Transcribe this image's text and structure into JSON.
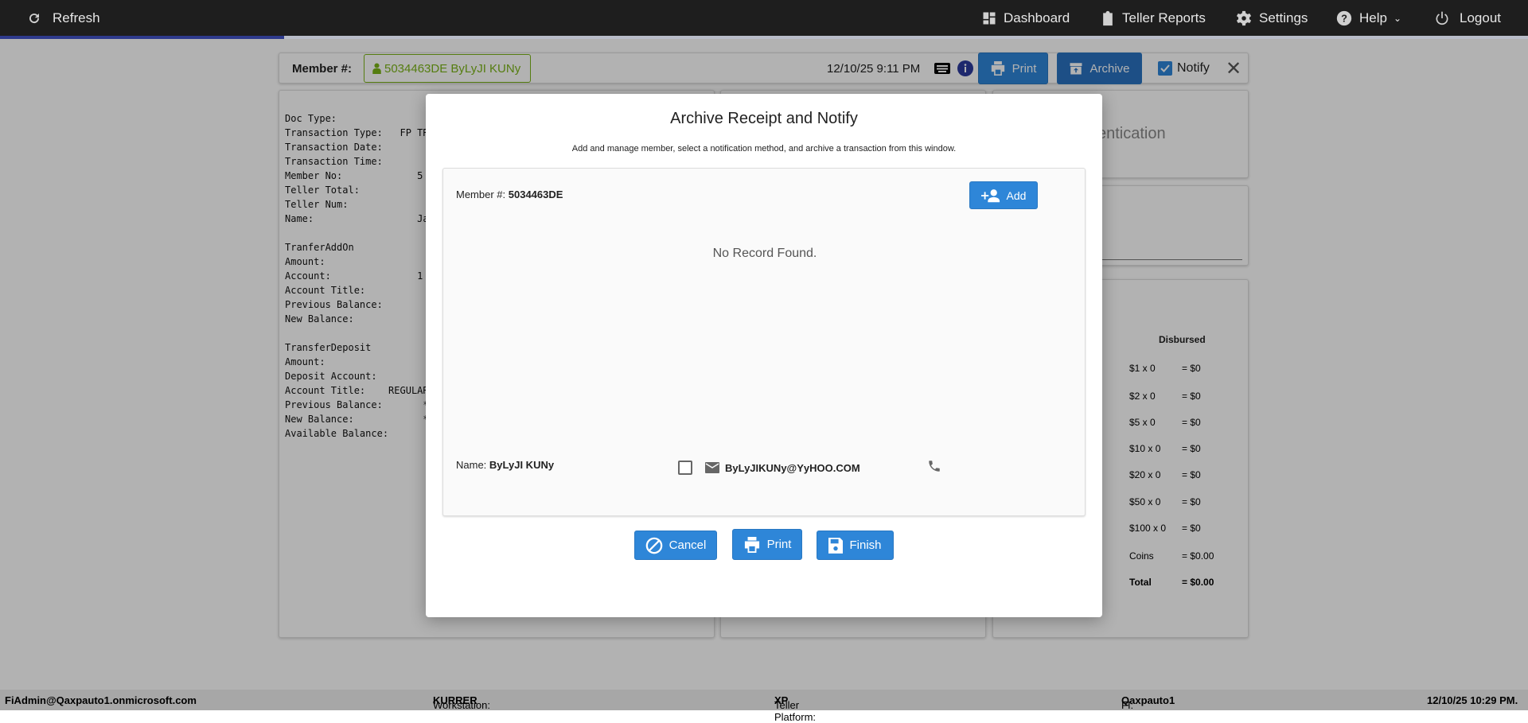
{
  "topbar": {
    "refresh": "Refresh",
    "dashboard": "Dashboard",
    "teller_reports": "Teller Reports",
    "settings": "Settings",
    "help": "Help",
    "logout": "Logout"
  },
  "progress_percent": 18.6,
  "header": {
    "member_label": "Member #:",
    "member_chip": "5034463DE ByLyJI KUNy",
    "datetime": "12/10/25 9:11 PM",
    "print": "Print",
    "archive": "Archive",
    "notify": "Notify",
    "notify_checked": true
  },
  "receipt": {
    "lines": [
      {
        "label": "Doc Type:",
        "value": ""
      },
      {
        "label": "Transaction Type:",
        "value": "   FP TRA"
      },
      {
        "label": "Transaction Date:",
        "value": ""
      },
      {
        "label": "Transaction Time:",
        "value": ""
      },
      {
        "label": "Member No:",
        "value": "             5"
      },
      {
        "label": "Teller Total:",
        "value": ""
      },
      {
        "label": "Teller Num:",
        "value": ""
      },
      {
        "label": "Name:",
        "value": "                  Ja"
      },
      {
        "label": "",
        "value": ""
      },
      {
        "label": "TranferAddOn",
        "value": ""
      },
      {
        "label": "Amount:",
        "value": ""
      },
      {
        "label": "Account:",
        "value": "               1"
      },
      {
        "label": "Account Title:",
        "value": ""
      },
      {
        "label": "Previous Balance:",
        "value": ""
      },
      {
        "label": "New Balance:",
        "value": ""
      },
      {
        "label": "",
        "value": ""
      },
      {
        "label": "TransferDeposit",
        "value": ""
      },
      {
        "label": "Amount:",
        "value": ""
      },
      {
        "label": "Deposit Account:",
        "value": ""
      },
      {
        "label": "Account Title:",
        "value": "    REGULAR"
      },
      {
        "label": "Previous Balance:",
        "value": "       *"
      },
      {
        "label": "New Balance:",
        "value": "            *"
      },
      {
        "label": "Available Balance:",
        "value": ""
      }
    ]
  },
  "right": {
    "auth_partial": "entication",
    "disbursed_title": "Disbursed",
    "rows": [
      {
        "d": "$1 x 0",
        "v": "= $0"
      },
      {
        "d": "$2 x 0",
        "v": "= $0"
      },
      {
        "d": "$5 x 0",
        "v": "= $0"
      },
      {
        "d": "$10 x 0",
        "v": "= $0"
      },
      {
        "d": "$20 x 0",
        "v": "= $0"
      },
      {
        "d": "$50 x 0",
        "v": "= $0"
      },
      {
        "d": "$100 x 0",
        "v": "= $0"
      },
      {
        "d": "Coins",
        "v": "= $0.00"
      },
      {
        "d": "Total",
        "v": "= $0.00"
      }
    ]
  },
  "modal": {
    "title": "Archive Receipt and Notify",
    "subtitle": "Add and manage member, select a notification method, and archive a transaction from this window.",
    "member_label": "Member #:",
    "member_value": "5034463DE",
    "add": "Add",
    "empty": "No Record Found.",
    "name_label": "Name:",
    "name_value": "ByLyJI KUNy",
    "email": "ByLyJIKUNy@YyHOO.COM",
    "email_checked": false,
    "cancel": "Cancel",
    "print": "Print",
    "finish": "Finish"
  },
  "status": {
    "user": "FiAdmin@Qaxpauto1.onmicrosoft.com",
    "ws_label": "Workstation:",
    "ws": "KURRER",
    "tp_label": "Teller Platform:",
    "tp": "XP",
    "fi_label": "FI:",
    "fi": "Qaxpauto1",
    "datetime": "12/10/25 10:29 PM."
  }
}
